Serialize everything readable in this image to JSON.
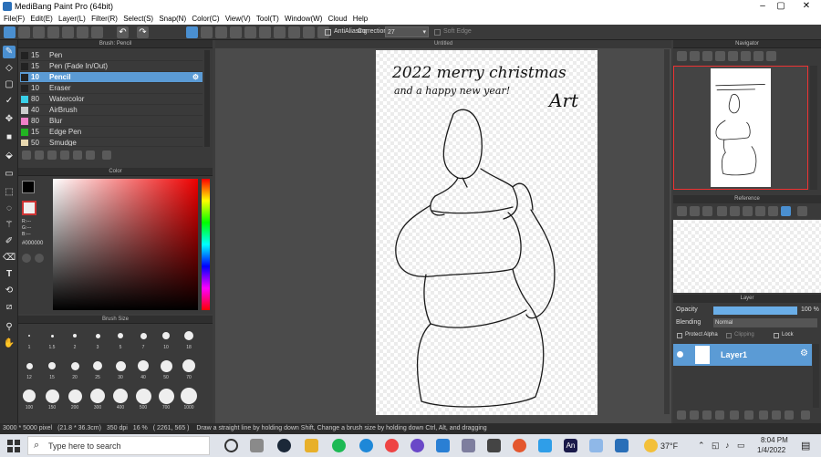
{
  "window": {
    "title": "MediBang Paint Pro (64bit)"
  },
  "menu": [
    "File(F)",
    "Edit(E)",
    "Layer(L)",
    "Filter(R)",
    "Select(S)",
    "Snap(N)",
    "Color(C)",
    "View(V)",
    "Tool(T)",
    "Window(W)",
    "Cloud",
    "Help"
  ],
  "toolbar": {
    "antialiasing_label": "AntiAliasing",
    "correction_label": "Correction",
    "correction_value": "27",
    "soft_edge_label": "Soft Edge"
  },
  "canvas": {
    "tab_title": "Untitled"
  },
  "brush_panel": {
    "title": "Brush: Pencil",
    "items": [
      {
        "size": "15",
        "name": "Pen",
        "color": "#222222"
      },
      {
        "size": "15",
        "name": "Pen (Fade In/Out)",
        "color": "#222222"
      },
      {
        "size": "10",
        "name": "Pencil",
        "color": "#222222",
        "selected": true
      },
      {
        "size": "10",
        "name": "Eraser",
        "color": "#222222"
      },
      {
        "size": "80",
        "name": "Watercolor",
        "color": "#39d0e8"
      },
      {
        "size": "40",
        "name": "AirBrush",
        "color": "#cccccc"
      },
      {
        "size": "80",
        "name": "Blur",
        "color": "#f080c8"
      },
      {
        "size": "15",
        "name": "Edge Pen",
        "color": "#22b422"
      },
      {
        "size": "50",
        "name": "Smudge",
        "color": "#e8d8b0"
      }
    ]
  },
  "color_panel": {
    "title": "Color",
    "r": "R:---",
    "g": "G:---",
    "b": "B:---",
    "hex": "#000000",
    "primary": "#000000",
    "secondary": "#ffffff"
  },
  "size_panel": {
    "title": "Brush Size",
    "sizes": [
      "1",
      "1.5",
      "2",
      "3",
      "5",
      "7",
      "10",
      "18",
      "12",
      "15",
      "20",
      "25",
      "30",
      "40",
      "50",
      "70",
      "100",
      "150",
      "200",
      "300",
      "400",
      "500",
      "700",
      "1000"
    ]
  },
  "navigator": {
    "title": "Navigator"
  },
  "reference": {
    "title": "Reference"
  },
  "layer_panel": {
    "title": "Layer",
    "opacity_label": "Opacity",
    "opacity_value": "100 %",
    "opacity_fraction": 1.0,
    "blending_label": "Blending",
    "blending_value": "Normal",
    "protect_alpha": "Protect Alpha",
    "clipping": "Clipping",
    "lock": "Lock",
    "layers": [
      {
        "name": "Layer1"
      }
    ]
  },
  "artwork_text": {
    "line1": "2022 merry christmas",
    "line2": "and a happy new year!",
    "line3": "Art"
  },
  "status": {
    "size": "3000 * 5000 pixel",
    "dims": "(21.8 * 36.3cm)",
    "dpi": "350 dpi",
    "zoom": "16 %",
    "coords": "( 2261, 565 )",
    "hint": "Draw a straight line by holding down Shift, Change a brush size by holding down Ctrl, Alt, and dragging"
  },
  "taskbar": {
    "search_placeholder": "Type here to search",
    "temp": "37°F",
    "time": "8:04 PM",
    "date": "1/4/2022"
  }
}
